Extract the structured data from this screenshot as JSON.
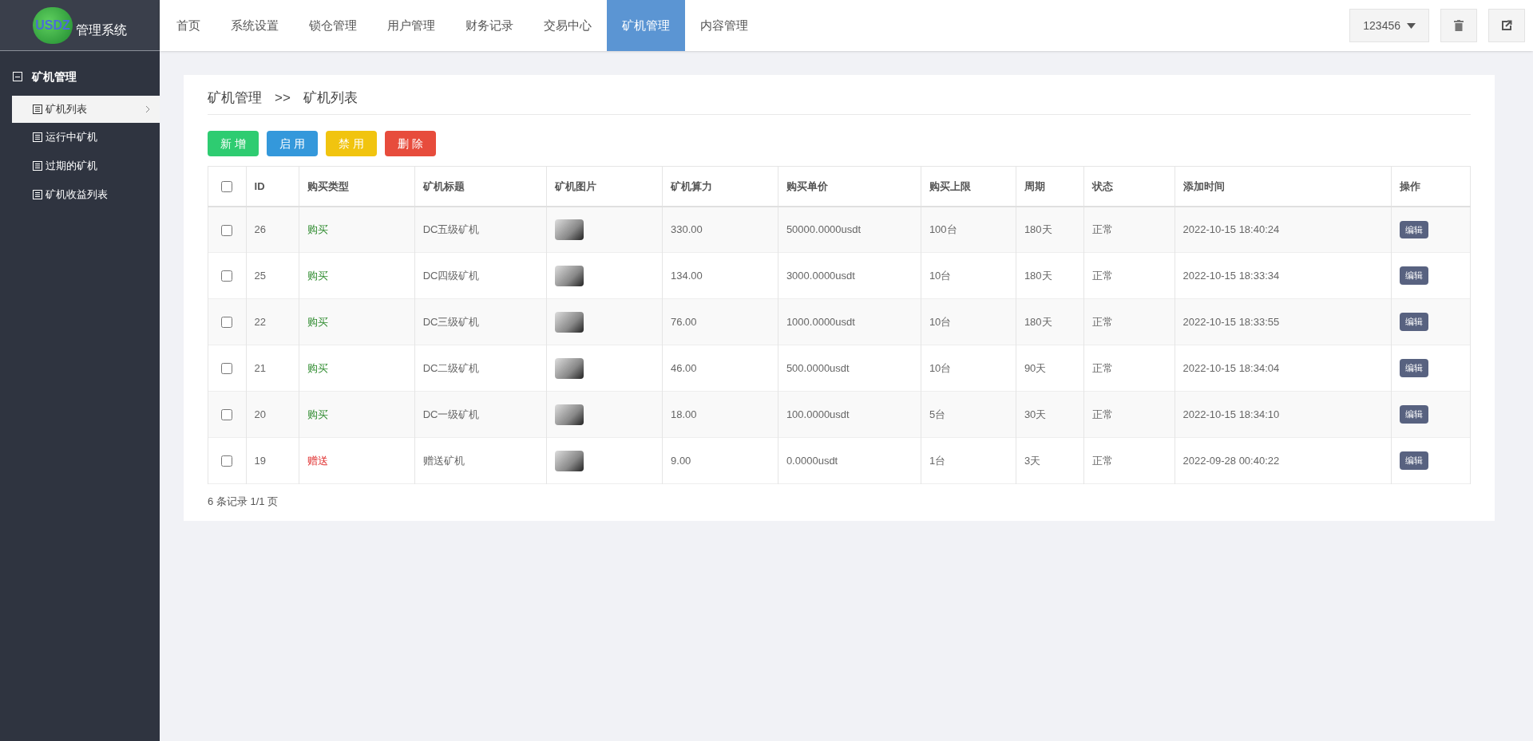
{
  "logo": {
    "badge": "USDZ",
    "title": "管理系统"
  },
  "nav": [
    {
      "label": "首页",
      "selected": false
    },
    {
      "label": "系统设置",
      "selected": false
    },
    {
      "label": "锁仓管理",
      "selected": false
    },
    {
      "label": "用户管理",
      "selected": false
    },
    {
      "label": "财务记录",
      "selected": false
    },
    {
      "label": "交易中心",
      "selected": false
    },
    {
      "label": "矿机管理",
      "selected": true
    },
    {
      "label": "内容管理",
      "selected": false
    }
  ],
  "user": {
    "name": "123456"
  },
  "sidebar": {
    "group": "矿机管理",
    "expanded": true,
    "items": [
      {
        "label": "矿机列表",
        "selected": true
      },
      {
        "label": "运行中矿机",
        "selected": false
      },
      {
        "label": "过期的矿机",
        "selected": false
      },
      {
        "label": "矿机收益列表",
        "selected": false
      }
    ]
  },
  "breadcrumb": {
    "parent": "矿机管理",
    "separator": ">>",
    "current": "矿机列表"
  },
  "actions": [
    {
      "label": "新 增",
      "kind": "add"
    },
    {
      "label": "启 用",
      "kind": "enable"
    },
    {
      "label": "禁 用",
      "kind": "disable"
    },
    {
      "label": "删 除",
      "kind": "delete"
    }
  ],
  "table": {
    "select_all_checked": false,
    "columns": [
      "ID",
      "购买类型",
      "矿机标题",
      "矿机图片",
      "矿机算力",
      "购买单价",
      "购买上限",
      "周期",
      "状态",
      "添加时间",
      "操作"
    ],
    "rows": [
      {
        "checked": false,
        "id": "26",
        "type": "购买",
        "color": "#2e8b2e",
        "title": "DC五级矿机",
        "power": "330.00",
        "price": "50000.0000usdt",
        "limit": "100台",
        "cycle": "180天",
        "status": "正常",
        "time": "2022-10-15 18:40:24",
        "action": "编辑"
      },
      {
        "checked": false,
        "id": "25",
        "type": "购买",
        "color": "#2e8b2e",
        "title": "DC四级矿机",
        "power": "134.00",
        "price": "3000.0000usdt",
        "limit": "10台",
        "cycle": "180天",
        "status": "正常",
        "time": "2022-10-15 18:33:34",
        "action": "编辑"
      },
      {
        "checked": false,
        "id": "22",
        "type": "购买",
        "color": "#2e8b2e",
        "title": "DC三级矿机",
        "power": "76.00",
        "price": "1000.0000usdt",
        "limit": "10台",
        "cycle": "180天",
        "status": "正常",
        "time": "2022-10-15 18:33:55",
        "action": "编辑"
      },
      {
        "checked": false,
        "id": "21",
        "type": "购买",
        "color": "#2e8b2e",
        "title": "DC二级矿机",
        "power": "46.00",
        "price": "500.0000usdt",
        "limit": "10台",
        "cycle": "90天",
        "status": "正常",
        "time": "2022-10-15 18:34:04",
        "action": "编辑"
      },
      {
        "checked": false,
        "id": "20",
        "type": "购买",
        "color": "#2e8b2e",
        "title": "DC一级矿机",
        "power": "18.00",
        "price": "100.0000usdt",
        "limit": "5台",
        "cycle": "30天",
        "status": "正常",
        "time": "2022-10-15 18:34:10",
        "action": "编辑"
      },
      {
        "checked": false,
        "id": "19",
        "type": "赠送",
        "color": "#e03030",
        "title": "赠送矿机",
        "power": "9.00",
        "price": "0.0000usdt",
        "limit": "1台",
        "cycle": "3天",
        "status": "正常",
        "time": "2022-09-28 00:40:22",
        "action": "编辑"
      }
    ]
  },
  "footer": "6 条记录 1/1 页"
}
